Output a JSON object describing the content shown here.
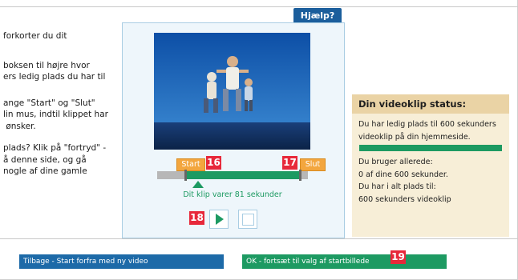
{
  "help_tab": {
    "label": "Hjælp?"
  },
  "left_text": [
    "forkorter du dit",
    "boksen til højre hvor\ners ledig plads du har til",
    "ange \"Start\" og \"Slut\"\nlin mus, indtil klippet har\n ønsker.",
    "plads? Klik på \"fortryd\" -\nå denne side, og gå\nnogle af dine gamle"
  ],
  "editor": {
    "start_label": "Start",
    "slut_label": "Slut",
    "duration_text": "Dit klip varer 81 sekunder",
    "clip_start_fraction": 0.19,
    "clip_end_fraction": 0.95
  },
  "badges": {
    "b16": "16",
    "b17": "17",
    "b18": "18",
    "b19": "19"
  },
  "status": {
    "title": "Din videoklip status:",
    "available_text": "Du har ledig plads til 600 sekunders\nvideoklip på din hjemmeside.",
    "usage_text": "Du bruger allerede:\n0 af dine 600 sekunder.\nDu har i alt plads til:\n600 sekunders videoklip",
    "used_fraction": 1.0
  },
  "buttons": {
    "back_label": "Tilbage - Start forfra med ny video",
    "ok_label": "OK - fortsæt til valg af startbillede"
  },
  "colors": {
    "accent_blue": "#1d6aa8",
    "accent_green": "#1d9a62",
    "marker_orange": "#f3a63e",
    "badge_red": "#e7283a",
    "status_bg": "#f7eed7",
    "status_head": "#ead3a5"
  }
}
